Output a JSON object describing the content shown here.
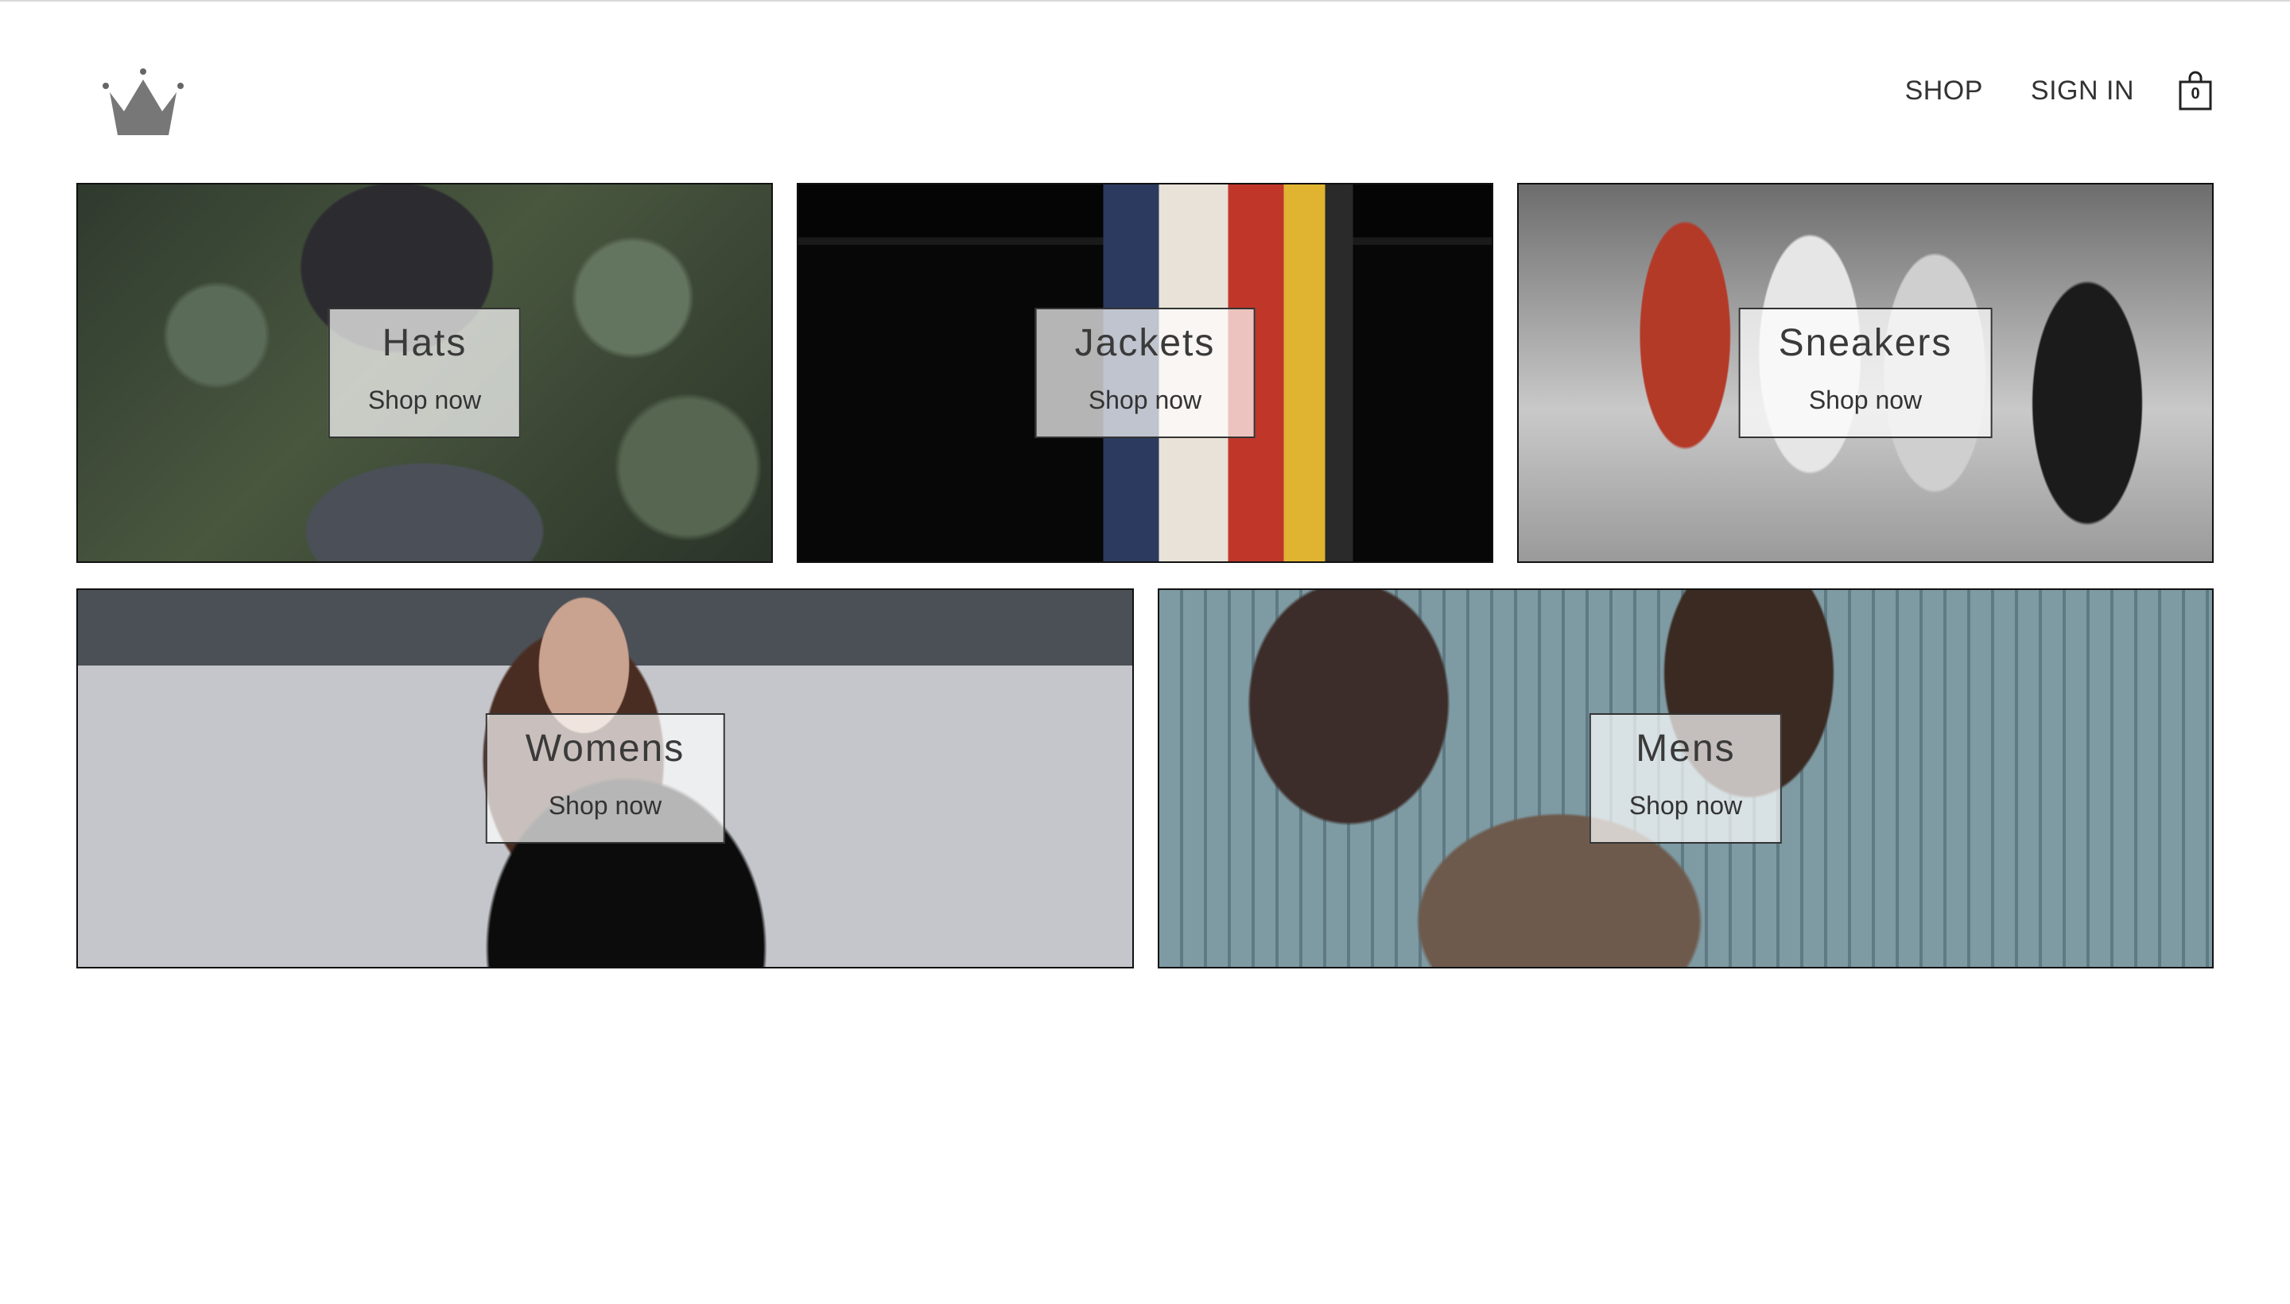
{
  "header": {
    "logo_icon": "crown-icon",
    "nav": {
      "shop": "SHOP",
      "sign_in": "SIGN IN"
    },
    "cart": {
      "icon": "shopping-bag-icon",
      "count": "0"
    }
  },
  "categories": [
    {
      "title": "Hats",
      "cta": "Shop now"
    },
    {
      "title": "Jackets",
      "cta": "Shop now"
    },
    {
      "title": "Sneakers",
      "cta": "Shop now"
    },
    {
      "title": "Womens",
      "cta": "Shop now"
    },
    {
      "title": "Mens",
      "cta": "Shop now"
    }
  ],
  "colors": {
    "background": "#ffffff",
    "text": "#333333",
    "border": "#111111",
    "label_box": "rgba(255,255,255,0.70)"
  }
}
